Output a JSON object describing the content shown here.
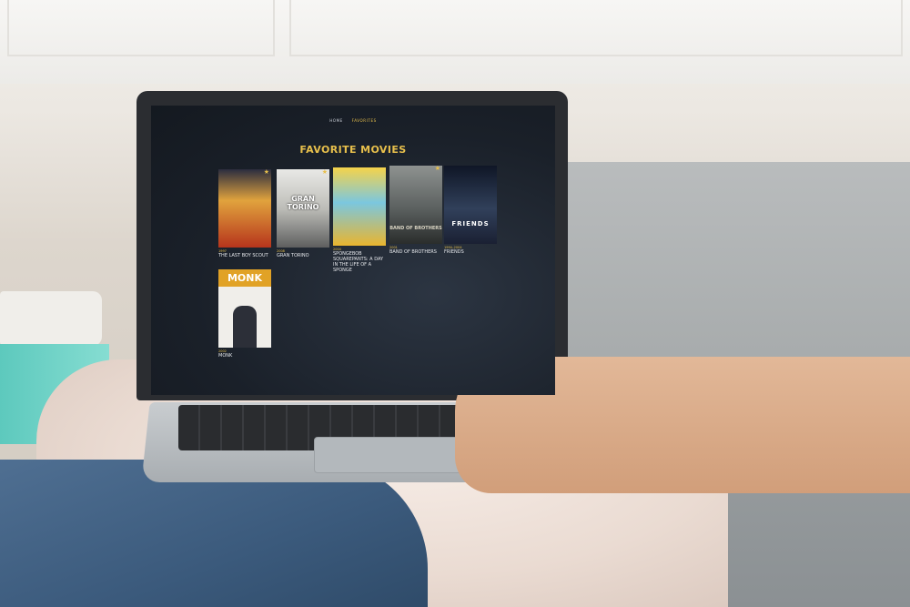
{
  "nav": {
    "items": [
      {
        "label": "HOME",
        "active": false
      },
      {
        "label": "FAVORITES",
        "active": true
      }
    ]
  },
  "page": {
    "heading": "FAVORITE MOVIES"
  },
  "accent_color": "#e8c04c",
  "movies": [
    {
      "year": "1997",
      "title": "THE LAST BOY SCOUT",
      "favorite": true
    },
    {
      "year": "2008",
      "title": "GRAN TORINO",
      "favorite": true,
      "poster_text": "GRAN TORINO"
    },
    {
      "year": "2004",
      "title": "SPONGEBOB SQUAREPANTS: A DAY IN THE LIFE OF A SPONGE",
      "favorite": false
    },
    {
      "year": "2001",
      "title": "BAND OF BROTHERS",
      "favorite": true,
      "poster_text": "BAND OF BROTHERS"
    },
    {
      "year": "1994–2004",
      "title": "FRIENDS",
      "favorite": false,
      "poster_text": "FRIENDS"
    },
    {
      "year": "2002",
      "title": "MONK",
      "favorite": false,
      "poster_text": "MONK"
    }
  ]
}
